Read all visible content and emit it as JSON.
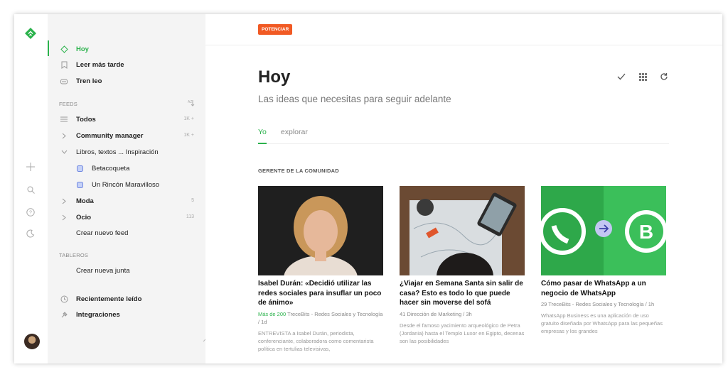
{
  "sidebar": {
    "nav": [
      {
        "label": "Hoy"
      },
      {
        "label": "Leer más tarde"
      },
      {
        "label": "Tren leo"
      }
    ],
    "feeds_section": "FEEDS",
    "feeds": [
      {
        "label": "Todos",
        "count": "1K +"
      },
      {
        "label": "Community manager",
        "count": "1K +"
      },
      {
        "label": "Libros, textos ... Inspiración",
        "count": ""
      },
      {
        "label": "Betacoqueta",
        "count": ""
      },
      {
        "label": "Un Rincón Maravilloso",
        "count": ""
      },
      {
        "label": "Moda",
        "count": "5"
      },
      {
        "label": "Ocio",
        "count": "113"
      }
    ],
    "create_feed": "Crear nuevo feed",
    "boards_section": "TABLEROS",
    "create_board": "Crear nueva junta",
    "recent": "Recientemente leído",
    "integrations": "Integraciones"
  },
  "main": {
    "boost_label": "POTENCIAR",
    "title": "Hoy",
    "subtitle": "Las ideas que necesitas para seguir adelante",
    "tabs": [
      {
        "label": "Yo"
      },
      {
        "label": "explorar"
      }
    ],
    "section_label": "GERENTE DE LA COMUNIDAD",
    "cards": [
      {
        "title": "Isabel Durán: «Decidió utilizar las redes sociales para insuflar un poco de ánimo»",
        "count": "Más de 200",
        "source": "TreceBits - Redes Sociales y Tecnología / 1d",
        "excerpt": "ENTREVISTA a Isabel Durán, periodista, conferenciante, colaboradora como comentarista política en tertulias televisivas,"
      },
      {
        "title": "¿Viajar en Semana Santa sin salir de casa? Esto es todo lo que puede hacer sin moverse del sofá",
        "count": "41",
        "source": "Dirección de Marketing / 3h",
        "excerpt": "Desde el famoso yacimiento arqueológico de Petra (Jordania) hasta el Templo Luxor en Egipto, decenas son las posibilidades"
      },
      {
        "title": "Cómo pasar de WhatsApp a un negocio de WhatsApp",
        "count": "29",
        "source": "TreceBits - Redes Sociales y Tecnología / 1h",
        "excerpt": "WhatsApp Business es una aplicación de uso gratuito diseñada por WhatsApp para las pequeñas empresas y los grandes"
      }
    ]
  },
  "colors": {
    "accent": "#2bb24c",
    "boost": "#f15a24"
  }
}
